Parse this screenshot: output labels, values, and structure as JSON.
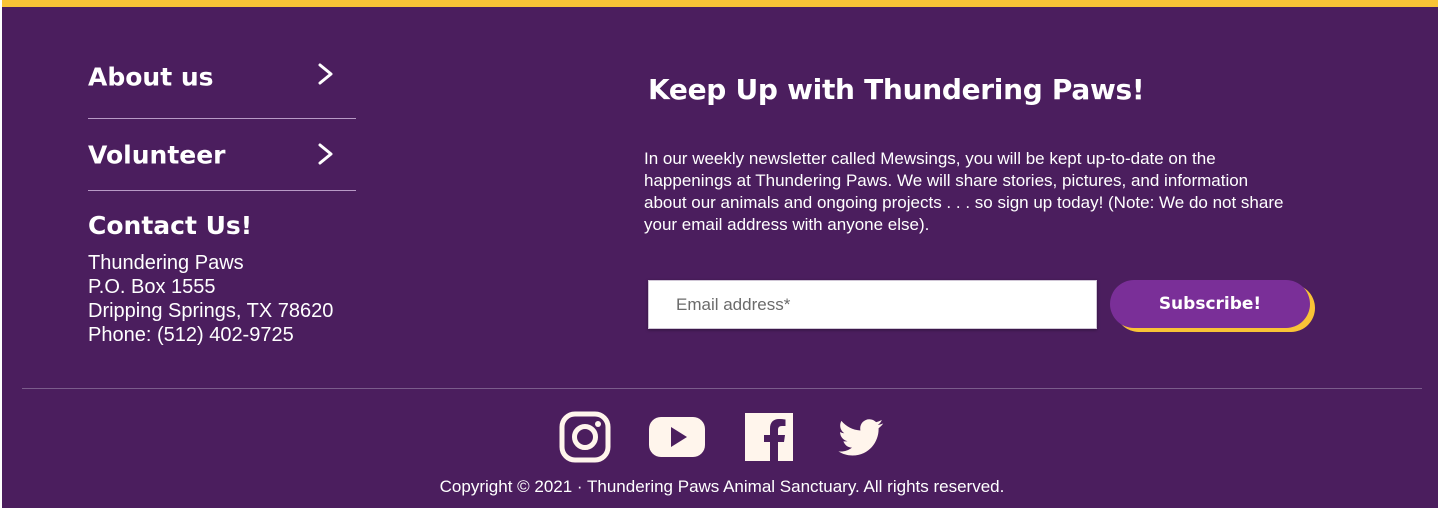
{
  "nav": {
    "items": [
      {
        "label": "About us"
      },
      {
        "label": "Volunteer"
      }
    ]
  },
  "contact": {
    "title": "Contact Us!",
    "lines": [
      "Thundering Paws",
      "P.O. Box 1555",
      "Dripping Springs, TX 78620",
      "Phone: (512) 402-9725"
    ]
  },
  "newsletter": {
    "title": "Keep Up with Thundering Paws!",
    "body": "In our weekly newsletter called Mewsings, you will be kept up-to-date on the happenings at Thundering Paws.  We will share stories, pictures, and information about our animals and ongoing projects . . . so sign up today! (Note: We do not share your email address with anyone else).",
    "email_placeholder": "Email address*",
    "email_value": "",
    "subscribe_label": "Subscribe!"
  },
  "social": [
    {
      "icon": "instagram-icon"
    },
    {
      "icon": "youtube-icon"
    },
    {
      "icon": "facebook-icon"
    },
    {
      "icon": "twitter-icon"
    }
  ],
  "copyright": "Copyright © 2021 · Thundering Paws Animal Sanctuary. All rights reserved.",
  "colors": {
    "background": "#4b1e5e",
    "accent_top_border": "#f9c336",
    "button": "#7a2f98",
    "button_shadow": "#f9c336",
    "icon": "#fff5ec"
  }
}
